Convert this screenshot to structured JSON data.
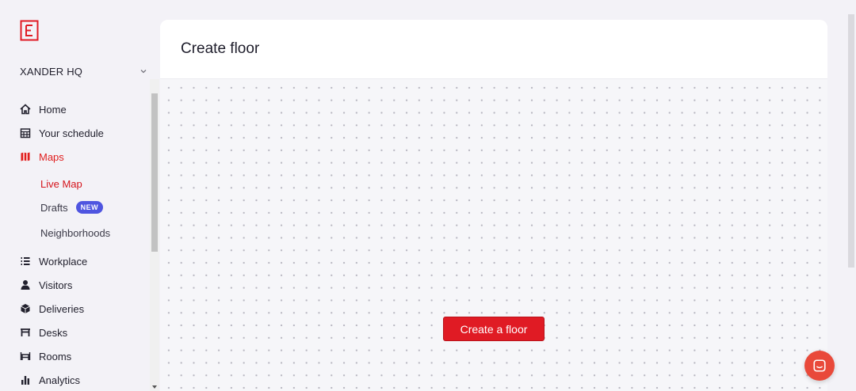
{
  "app": {
    "logo_letter": "E",
    "accent_color": "#e01b24"
  },
  "location": {
    "name": "XANDER HQ",
    "icon": "chevron-down-icon"
  },
  "nav": {
    "home": {
      "label": "Home",
      "icon": "home-icon"
    },
    "schedule": {
      "label": "Your schedule",
      "icon": "calendar-icon"
    },
    "maps": {
      "label": "Maps",
      "icon": "map-icon"
    },
    "live_map": {
      "label": "Live Map"
    },
    "drafts": {
      "label": "Drafts",
      "badge": "NEW"
    },
    "neighborhoods": {
      "label": "Neighborhoods"
    },
    "workplace": {
      "label": "Workplace",
      "icon": "list-icon"
    },
    "visitors": {
      "label": "Visitors",
      "icon": "person-icon"
    },
    "deliveries": {
      "label": "Deliveries",
      "icon": "package-icon"
    },
    "desks": {
      "label": "Desks",
      "icon": "desk-icon"
    },
    "rooms": {
      "label": "Rooms",
      "icon": "table-icon"
    },
    "analytics": {
      "label": "Analytics",
      "icon": "bar-chart-icon"
    }
  },
  "main": {
    "title": "Create floor",
    "create_button": "Create a floor"
  },
  "chat": {
    "icon": "chat-icon",
    "color": "#e9493a"
  }
}
